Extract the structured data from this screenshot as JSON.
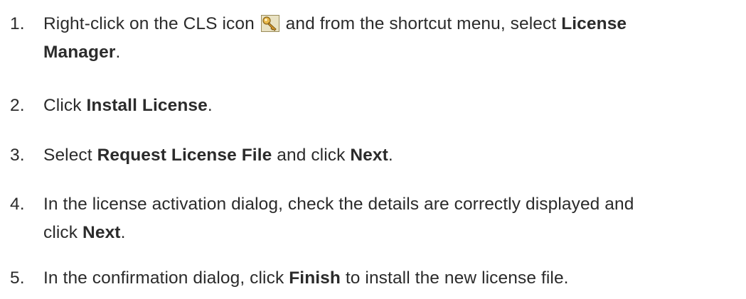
{
  "steps": [
    {
      "num": "1.",
      "pre": "Right-click on the CLS icon",
      "icon": "key-icon",
      "mid": " and from the shortcut menu, select ",
      "bold1": "License",
      "line2_bold": "Manager",
      "line2_post": "."
    },
    {
      "num": "2.",
      "pre": "Click ",
      "bold1": "Install License",
      "post": "."
    },
    {
      "num": "3.",
      "pre": "Select ",
      "bold1": "Request License File",
      "mid": " and click ",
      "bold2": "Next",
      "post": "."
    },
    {
      "num": "4.",
      "pre": "In the license activation dialog, check the details are correctly displayed and",
      "line2_pre": "click ",
      "line2_bold": "Next",
      "line2_post": "."
    },
    {
      "num": "5.",
      "pre": "In the confirmation dialog, click ",
      "bold1": "Finish",
      "post": " to install the new license file."
    }
  ]
}
